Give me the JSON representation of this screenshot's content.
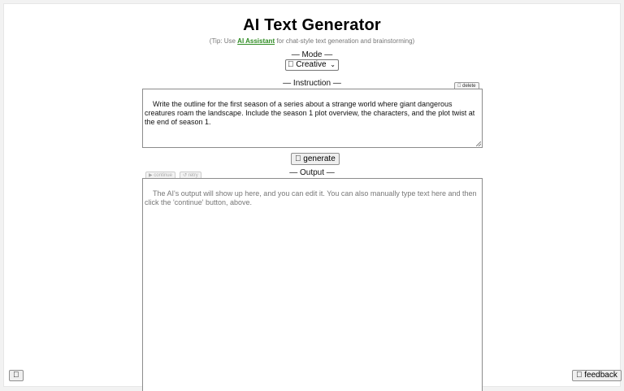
{
  "header": {
    "title": "AI Text Generator",
    "tip_prefix": "(Tip: Use ",
    "tip_link": "AI Assistant",
    "tip_suffix": " for chat-style text generation and brainstorming)"
  },
  "mode": {
    "label": "— Mode —",
    "icon": "",
    "selected": "Creative",
    "chevron": "⌄"
  },
  "instruction": {
    "label": "— Instruction —",
    "delete_icon": "",
    "delete_label": "delete",
    "text": "Write the outline for the first season of a series about a strange world where giant dangerous creatures roam the landscape. Include the season 1 plot overview, the characters, and the plot twist at the end of season 1."
  },
  "generate": {
    "icon": "",
    "label": "generate"
  },
  "output": {
    "label": "— Output —",
    "continue_label": "▶ continue",
    "retry_label": "↺ retry",
    "placeholder": "The AI's output will show up here, and you can edit it. You can also manually type text here and then click the 'continue' button, above."
  },
  "footer": {
    "settings_icon": "",
    "feedback_icon": "",
    "feedback_label": "feedback"
  },
  "colors": {
    "link": "#2e8b22",
    "background": "#f2f2f2",
    "panel": "#ffffff"
  }
}
